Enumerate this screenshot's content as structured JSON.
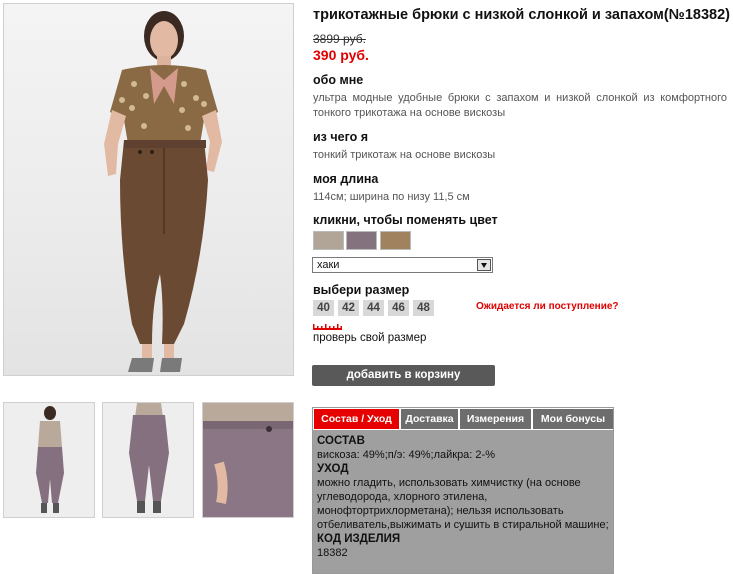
{
  "product": {
    "title": "трикотажные брюки с низкой слонкой и запахом(№18382)",
    "old_price": "3899 руб.",
    "new_price": "390 руб."
  },
  "about": {
    "heading": "обо мне",
    "text": "ультра модные удобные брюки с запахом и низкой слонкой из комфортного тонкого трикотажа на основе вискозы"
  },
  "material": {
    "heading": "из чего я",
    "text": "тонкий трикотаж на основе вискозы"
  },
  "length": {
    "heading": "моя длина",
    "text": "114см; ширина по низу 11,5 см"
  },
  "color": {
    "heading": "кликни, чтобы поменять цвет",
    "swatches": [
      "#b1a597",
      "#85727f",
      "#a0825f"
    ],
    "selected": "хаки"
  },
  "size": {
    "heading": "выбери размер",
    "options": [
      "40",
      "42",
      "44",
      "46",
      "48"
    ],
    "expected_link": "Ожидается ли поступление?",
    "check_link": "проверь свой размер"
  },
  "cart": {
    "button": "добавить в корзину"
  },
  "tabs": {
    "items": [
      "Состав / Уход",
      "Доставка",
      "Измерения",
      "Мои бонусы"
    ],
    "active_color": "#e60000",
    "content": {
      "composition_heading": "СОСТАВ",
      "composition": "вискоза: 49%;п/э: 49%;лайкра: 2-%",
      "care_heading": "УХОД",
      "care": "можно гладить, использовать химчистку (на основе углеводорода, хлорного этилена, монофтортрихлорметана); нельзя использовать отбеливатель,выжимать и сушить в стиральной машине;",
      "code_heading": "КОД ИЗДЕЛИЯ",
      "code": "18382"
    }
  }
}
